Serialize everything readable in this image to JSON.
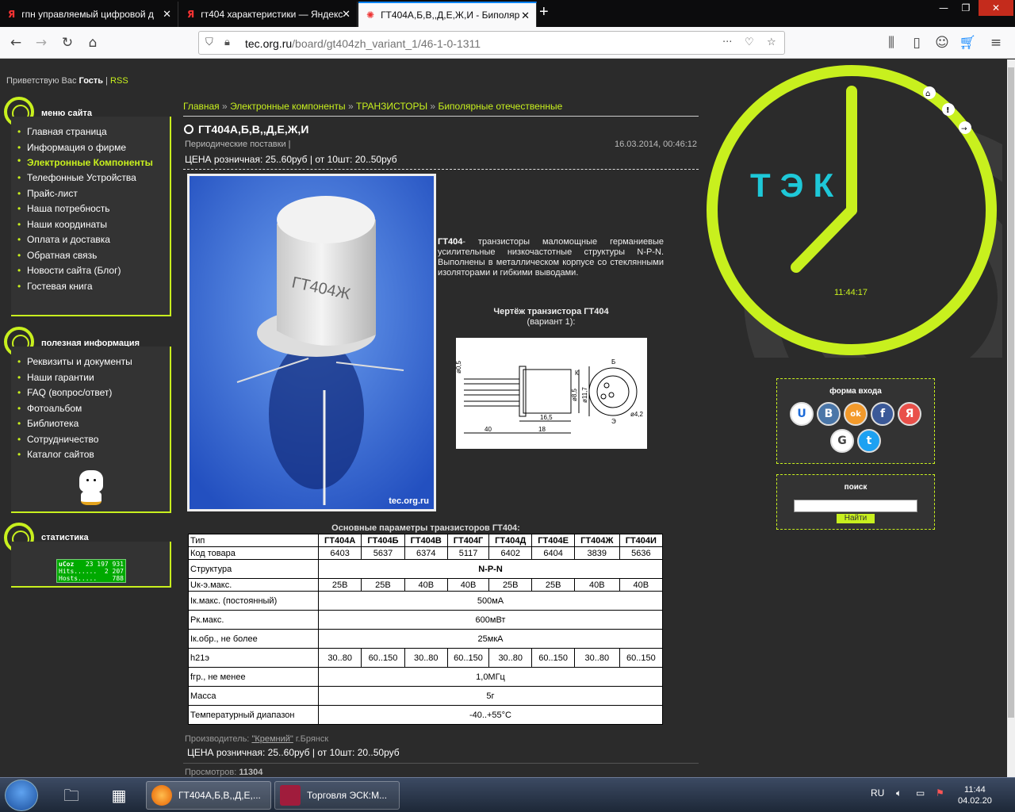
{
  "browser": {
    "tabs": [
      {
        "favicon": "Я",
        "title": "гпн управляемый цифровой д"
      },
      {
        "favicon": "Я",
        "title": "гт404 характеристики — Яндекс"
      },
      {
        "favicon": "✺",
        "title": "ГТ404А,Б,В,,Д,Е,Ж,И - Биполяр"
      }
    ],
    "url_host": "tec.org.ru",
    "url_path": "/board/gt404zh_variant_1/46-1-0-1311"
  },
  "header": {
    "greeting": "Приветствую Вас",
    "user": "Гость",
    "separator": "|",
    "rss": "RSS"
  },
  "sidebar": {
    "menu_title": "меню сайта",
    "menu_items": [
      "Главная страница",
      "Информация о фирме",
      "Электронные Компоненты",
      "Телефонные Устройства",
      "Прайс-лист",
      "Наша потребность",
      "Наши координаты",
      "Оплата и доставка",
      "Обратная связь",
      "Новости сайта (Блог)",
      "Гостевая книга"
    ],
    "info_title": "полезная информация",
    "info_items": [
      "Реквизиты и документы",
      "Наши гарантии",
      "FAQ (вопрос/ответ)",
      "Фотоальбом",
      "Библиотека",
      "Сотрудничество",
      "Каталог сайтов"
    ],
    "stats_title": "статистика",
    "counter": {
      "brand": "uCoz",
      "total": "23 197 931",
      "hits_label": "Hits......",
      "hits": "2 207",
      "hosts_label": "Hosts.....",
      "hosts": "788"
    }
  },
  "main": {
    "breadcrumbs": [
      "Главная",
      "Электронные компоненты",
      "ТРАНЗИСТОРЫ",
      "Биполярные отечественные"
    ],
    "breadcrumb_sep": "»",
    "title": "ГТ404А,Б,В,,Д,Е,Ж,И",
    "subtitle": "Периодические поставки |",
    "date": "16.03.2014, 00:46:12",
    "price": "ЦЕНА розничная: 25..60руб | от 10шт: 20..50руб",
    "photo_marking": "ГТ404Ж",
    "photo_watermark": "tec.org.ru",
    "desc_bold": "ГТ404",
    "desc_text": "- транзисторы маломощные германиевые усилительные низкочастотные структуры N-P-N. Выполнены в металлическом корпусе со стеклянными изоляторами и гибкими выводами.",
    "drawing_title": "Чертёж транзистора ГТ404",
    "drawing_sub": "(вариант 1):",
    "drawing_labels": {
      "k": "К",
      "b": "Б",
      "e": "Э",
      "d1": "ø0,5",
      "d2": "ø8,5",
      "d3": "ø11,7",
      "d4": "ø4,2",
      "l1": "16,5",
      "l2": "40",
      "l3": "18"
    },
    "params_title": "Основные параметры транзисторов ГТ404:",
    "params": {
      "header": [
        "Тип",
        "ГТ404А",
        "ГТ404Б",
        "ГТ404В",
        "ГТ404Г",
        "ГТ404Д",
        "ГТ404Е",
        "ГТ404Ж",
        "ГТ404И"
      ],
      "codes_label": "Код товара",
      "codes": [
        "6403",
        "5637",
        "6374",
        "5117",
        "6402",
        "6404",
        "3839",
        "5636"
      ],
      "structure_label": "Структура",
      "structure": "N-P-N",
      "uk_label": "Uк-э.макс.",
      "uk": [
        "25В",
        "25В",
        "40В",
        "40В",
        "25В",
        "25В",
        "40В",
        "40В"
      ],
      "ik_label": "Iк.макс. (постоянный)",
      "ik": "500мА",
      "pk_label": "Рк.макс.",
      "pk": "600мВт",
      "iko_label": "Iк.обр., не более",
      "iko": "25мкА",
      "h21_label": "h21э",
      "h21": [
        "30..80",
        "60..150",
        "30..80",
        "60..150",
        "30..80",
        "60..150",
        "30..80",
        "60..150"
      ],
      "fgr_label": "fгр., не менее",
      "fgr": "1,0МГц",
      "mass_label": "Масса",
      "mass": "5г",
      "temp_label": "Температурный диапазон",
      "temp": "-40..+55°С"
    },
    "maker_label": "Производитель:",
    "maker_name": "\"Кремний\"",
    "maker_city": "г.Брянск",
    "price_bottom": "ЦЕНА розничная: 25..60руб | от 10шт: 20..50руб",
    "views_label": "Просмотров:",
    "views": "11304"
  },
  "right": {
    "logo": "ТЭК",
    "time": "11:44:17",
    "login_title": "форма входа",
    "socials": [
      "U",
      "B",
      "ok",
      "f",
      "Я",
      "G",
      "t"
    ],
    "search_title": "поиск",
    "search_button": "Найти"
  },
  "taskbar": {
    "apps": [
      "ГТ404А,Б,В,,Д,Е,...",
      "Торговля ЭСК:М..."
    ],
    "lang": "RU",
    "time": "11:44",
    "date": "04.02.20"
  },
  "colors": {
    "accent": "#c8f01e",
    "bg": "#2b2b2b",
    "logo": "#1ec8d8"
  }
}
